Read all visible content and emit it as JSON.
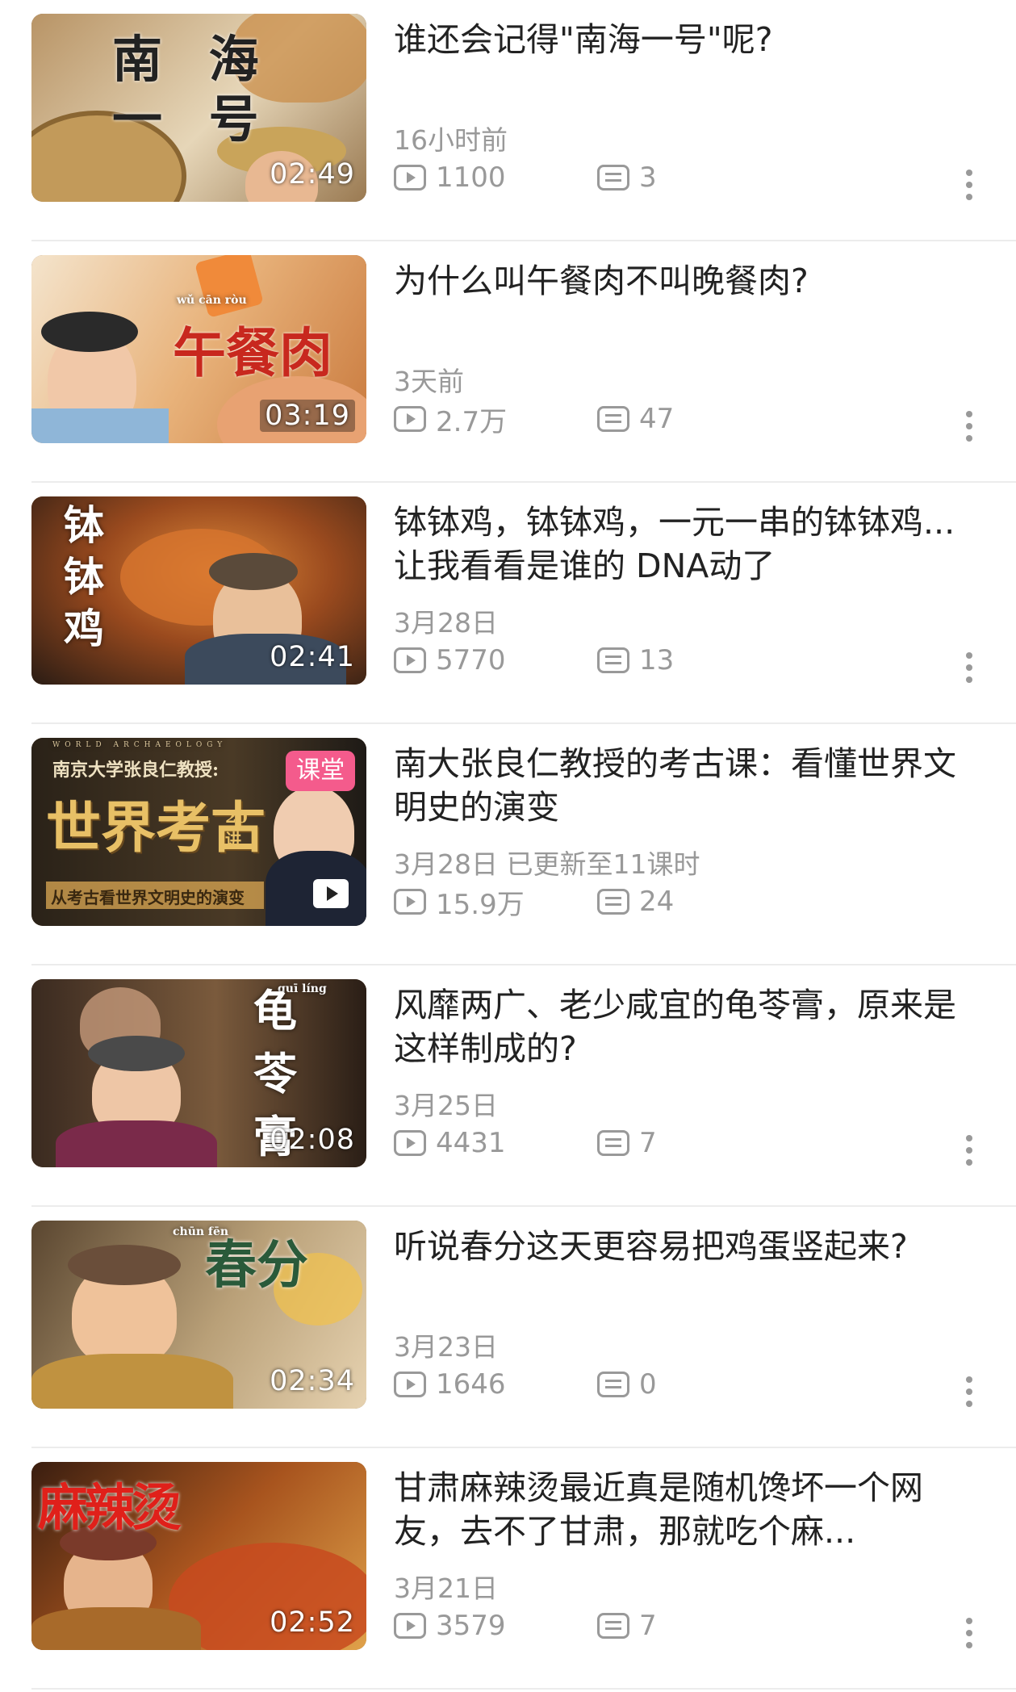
{
  "videos": [
    {
      "title": "谁还会记得\"南海一号\"呢?",
      "date": "16小时前",
      "views": "1100",
      "comments": "3",
      "duration": "02:49",
      "thumb_text": "南 海 一 号",
      "colors": {
        "bg1": "#a8865e",
        "bg2": "#d8c6a6"
      }
    },
    {
      "title": "为什么叫午餐肉不叫晚餐肉?",
      "date": "3天前",
      "views": "2.7万",
      "comments": "47",
      "duration": "03:19",
      "thumb_text": "午餐肉",
      "thumb_pinyin": "wǔ  cān  ròu",
      "colors": {
        "bg1": "#e0a063",
        "bg2": "#f1d3b1"
      }
    },
    {
      "title": "钵钵鸡，钵钵鸡，一元一串的钵钵鸡...让我看看是谁的 DNA动了",
      "date": "3月28日",
      "views": "5770",
      "comments": "13",
      "duration": "02:41",
      "thumb_text": "钵钵鸡",
      "colors": {
        "bg1": "#3a2a1e",
        "bg2": "#c9652c"
      }
    },
    {
      "title": "南大张良仁教授的考古课：看懂世界文明史的演变",
      "date": "3月28日 已更新至11课时",
      "views": "15.9万",
      "comments": "24",
      "badge": "课堂",
      "thumb_header": "南京大学张良仁教授:",
      "thumb_main": "世界考古",
      "thumb_count": "20讲",
      "thumb_sub": "从考古看世界文明史的演变",
      "thumb_tag": "WORLD ARCHAEOLOGY",
      "colors": {
        "bg1": "#2a2218",
        "bg2": "#5a4630"
      }
    },
    {
      "title": "风靡两广、老少咸宜的龟苓膏，原来是这样制成的?",
      "date": "3月25日",
      "views": "4431",
      "comments": "7",
      "duration": "02:08",
      "thumb_text": "龟苓膏",
      "thumb_pinyin": "guī  líng",
      "colors": {
        "bg1": "#2b1f18",
        "bg2": "#6a4a32"
      }
    },
    {
      "title": "听说春分这天更容易把鸡蛋竖起来?",
      "date": "3月23日",
      "views": "1646",
      "comments": "0",
      "duration": "02:34",
      "thumb_text": "春分",
      "thumb_pinyin": "chūn  fēn",
      "colors": {
        "bg1": "#5c4a32",
        "bg2": "#b59a6e"
      }
    },
    {
      "title": "甘肃麻辣烫最近真是随机馋坏一个网友，去不了甘肃，那就吃个麻...",
      "date": "3月21日",
      "views": "3579",
      "comments": "7",
      "duration": "02:52",
      "thumb_text": "麻辣烫",
      "colors": {
        "bg1": "#5a2a14",
        "bg2": "#d08a3a"
      }
    }
  ]
}
